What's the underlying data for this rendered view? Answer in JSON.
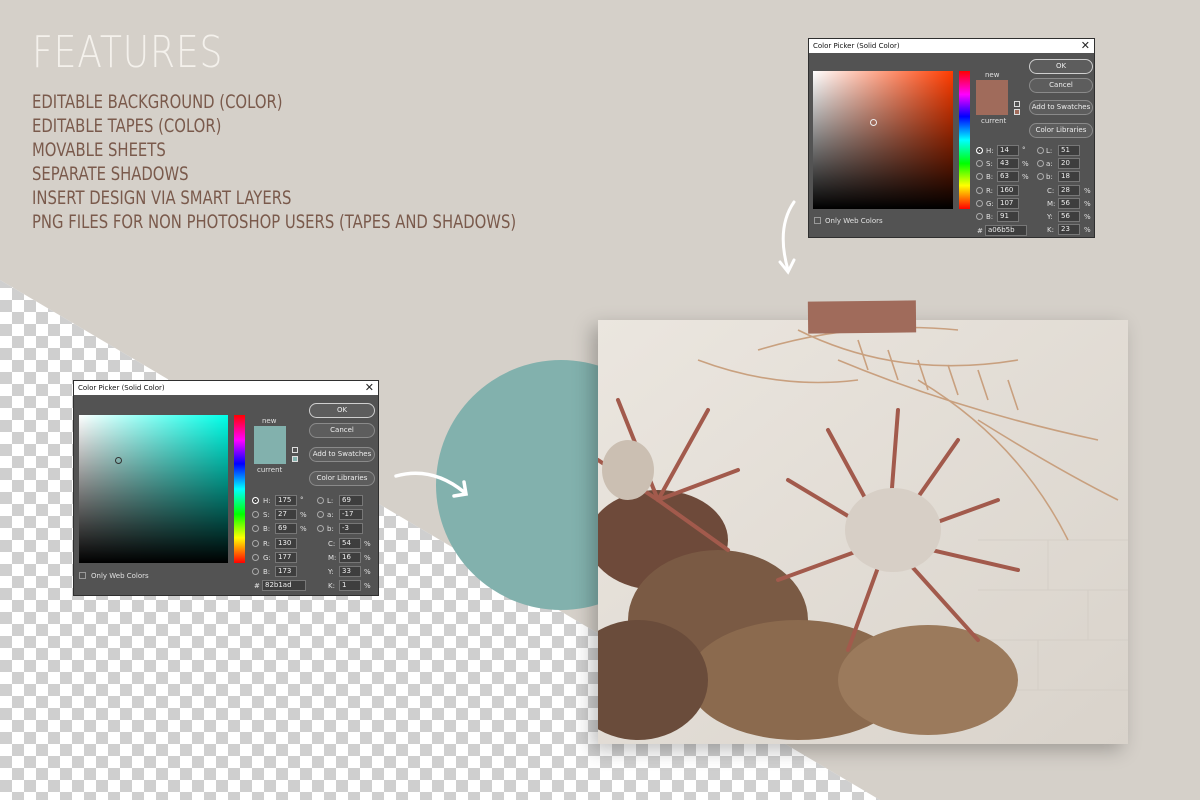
{
  "title": "FEATURES",
  "features": [
    "EDITABLE BACKGROUND (COLOR)",
    "EDITABLE TAPES (COLOR)",
    "MOVABLE SHEETS",
    "SEPARATE SHADOWS",
    "INSERT DESIGN VIA SMART LAYERS",
    "PNG FILES FOR NON PHOTOSHOP USERS (TAPES AND SHADOWS)"
  ],
  "colors": {
    "circle": "#82b1ad",
    "tape": "#a06b5b",
    "background": "#d5d0c9"
  },
  "picker_top": {
    "title": "Color Picker (Solid Color)",
    "label_new": "new",
    "label_current": "current",
    "ok": "OK",
    "cancel": "Cancel",
    "add_swatches": "Add to Swatches",
    "color_libraries": "Color Libraries",
    "only_web": "Only Web Colors",
    "hex_label": "#",
    "hex": "a06b5b",
    "H": "14",
    "H_unit": "°",
    "S": "43",
    "S_unit": "%",
    "B": "63",
    "B_unit": "%",
    "R": "160",
    "G": "107",
    "Bl": "91",
    "L": "51",
    "a": "20",
    "b": "18",
    "C": "28",
    "M": "56",
    "Y": "56",
    "K": "23",
    "pct": "%",
    "labels": {
      "H": "H:",
      "S": "S:",
      "B": "B:",
      "R": "R:",
      "G": "G:",
      "Bl": "B:",
      "L": "L:",
      "a": "a:",
      "b": "b:",
      "C": "C:",
      "M": "M:",
      "Y": "Y:",
      "K": "K:"
    }
  },
  "picker_bottom": {
    "title": "Color Picker (Solid Color)",
    "label_new": "new",
    "label_current": "current",
    "ok": "OK",
    "cancel": "Cancel",
    "add_swatches": "Add to Swatches",
    "color_libraries": "Color Libraries",
    "only_web": "Only Web Colors",
    "hex_label": "#",
    "hex": "82b1ad",
    "H": "175",
    "H_unit": "°",
    "S": "27",
    "S_unit": "%",
    "B": "69",
    "B_unit": "%",
    "R": "130",
    "G": "177",
    "Bl": "173",
    "L": "69",
    "a": "-17",
    "b": "-3",
    "C": "54",
    "M": "16",
    "Y": "33",
    "K": "1",
    "pct": "%",
    "labels": {
      "H": "H:",
      "S": "S:",
      "B": "B:",
      "R": "R:",
      "G": "G:",
      "Bl": "B:",
      "L": "L:",
      "a": "a:",
      "b": "b:",
      "C": "C:",
      "M": "M:",
      "Y": "Y:",
      "K": "K:"
    }
  }
}
